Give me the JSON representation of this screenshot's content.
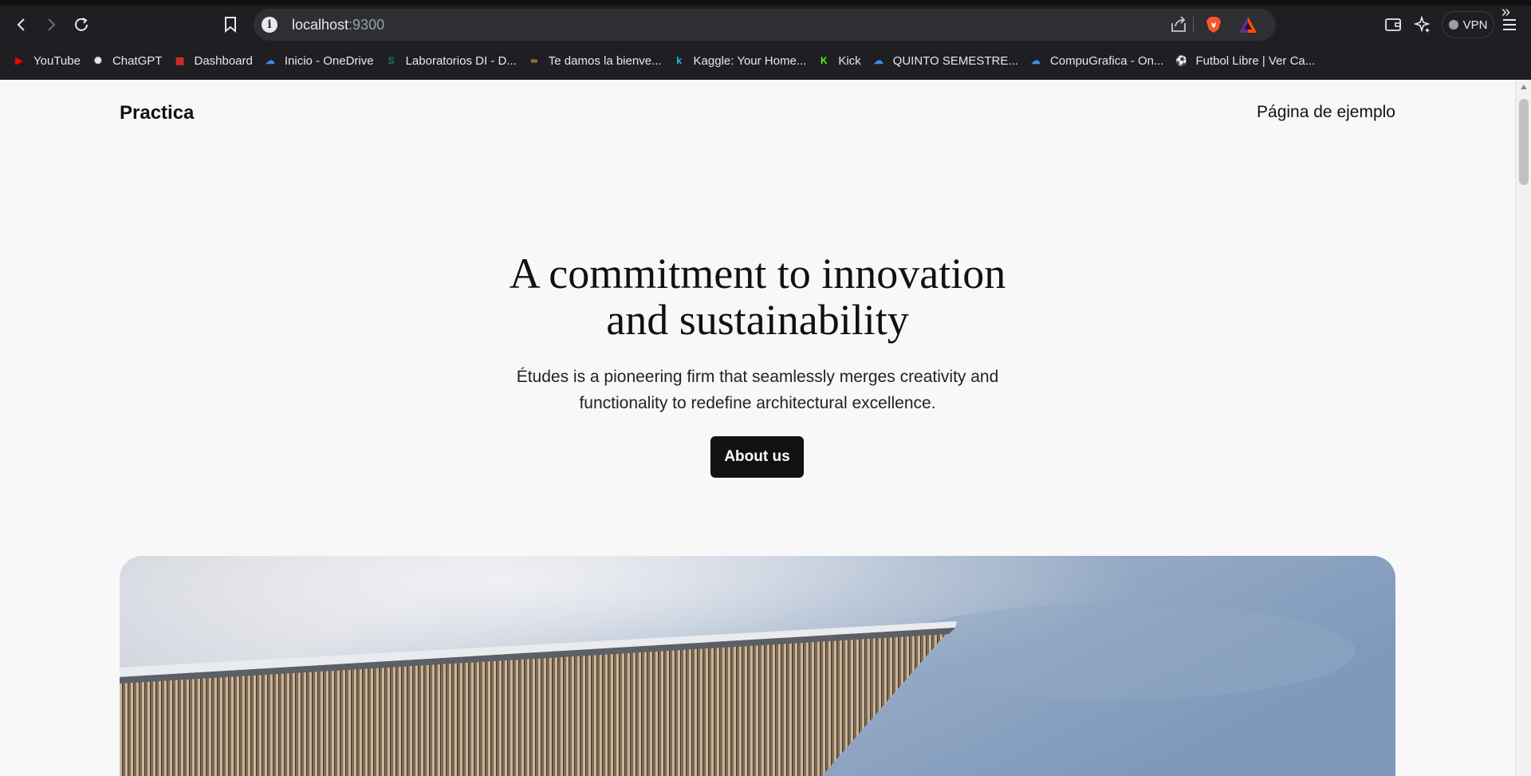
{
  "browser": {
    "url_host": "localhost",
    "url_port": ":9300",
    "vpn_label": "VPN",
    "bookmarks": [
      {
        "label": "YouTube",
        "icon": "youtube-icon",
        "color": "#ff0000"
      },
      {
        "label": "ChatGPT",
        "icon": "chatgpt-icon",
        "color": "#e8e8ea"
      },
      {
        "label": "Dashboard",
        "icon": "dashboard-icon",
        "color": "#d93025"
      },
      {
        "label": "Inicio - OneDrive",
        "icon": "onedrive-icon",
        "color": "#3a8ee6"
      },
      {
        "label": "Laboratorios DI - D...",
        "icon": "sharepoint-icon",
        "color": "#0f7b6c"
      },
      {
        "label": "Te damos la bienve...",
        "icon": "infinity-icon",
        "color": "#f2a33a"
      },
      {
        "label": "Kaggle: Your Home...",
        "icon": "kaggle-icon",
        "color": "#20beff"
      },
      {
        "label": "Kick",
        "icon": "kick-icon",
        "color": "#53fc18"
      },
      {
        "label": "QUINTO SEMESTRE...",
        "icon": "onedrive-icon",
        "color": "#3a8ee6"
      },
      {
        "label": "CompuGrafica - On...",
        "icon": "onedrive-icon",
        "color": "#3a8ee6"
      },
      {
        "label": "Futbol Libre | Ver Ca...",
        "icon": "soccer-ball-icon",
        "color": "#e8e8ea"
      }
    ]
  },
  "page": {
    "site_title": "Practica",
    "nav_link": "Página de ejemplo",
    "hero_heading_line1": "A commitment to innovation",
    "hero_heading_line2": "and sustainability",
    "hero_sub_line1": "Études is a pioneering firm that seamlessly merges creativity and",
    "hero_sub_line2": "functionality to redefine architectural excellence.",
    "about_button": "About us",
    "accent_color": "#111111",
    "background_color": "#f8f8f8"
  }
}
